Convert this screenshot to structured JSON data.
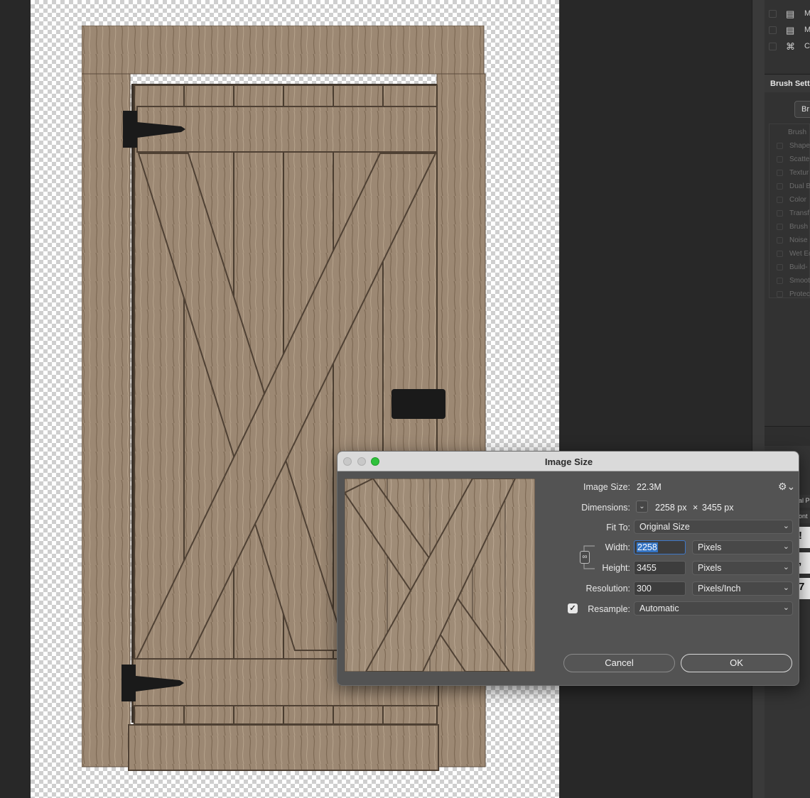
{
  "history_panel": {
    "items": [
      {
        "icon": "document-icon",
        "label": "M"
      },
      {
        "icon": "document-icon",
        "label": "M"
      },
      {
        "icon": "crop-icon",
        "label": "C"
      }
    ]
  },
  "brush_settings": {
    "title": "Brush Setti",
    "button_label": "Br",
    "items": [
      "Brush",
      "Shape",
      "Scatte",
      "Textur",
      "Dual B",
      "Color",
      "Transf",
      "Brush",
      "Noise",
      "Wet Ec",
      "Build-",
      "Smoot",
      "Protec"
    ]
  },
  "side_fragments": [
    "al P",
    "ont",
    "!",
    ",",
    "7"
  ],
  "dialog": {
    "title": "Image Size",
    "image_size_label": "Image Size:",
    "image_size_value": "22.3M",
    "dimensions_label": "Dimensions:",
    "dim_width": "2258 px",
    "dim_times": "×",
    "dim_height": "3455 px",
    "fit_to_label": "Fit To:",
    "fit_to_value": "Original Size",
    "width_label": "Width:",
    "width_value": "2258",
    "width_unit": "Pixels",
    "height_label": "Height:",
    "height_value": "3455",
    "height_unit": "Pixels",
    "resolution_label": "Resolution:",
    "resolution_value": "300",
    "resolution_unit": "Pixels/Inch",
    "resample_label": "Resample:",
    "resample_checked": true,
    "resample_value": "Automatic",
    "cancel_label": "Cancel",
    "ok_label": "OK"
  },
  "colors": {
    "app_bg": "#282828",
    "dialog_bg": "#535353",
    "selection": "#3474c4",
    "zoom_light": "#2fc13b",
    "wood": "#9a8670"
  }
}
